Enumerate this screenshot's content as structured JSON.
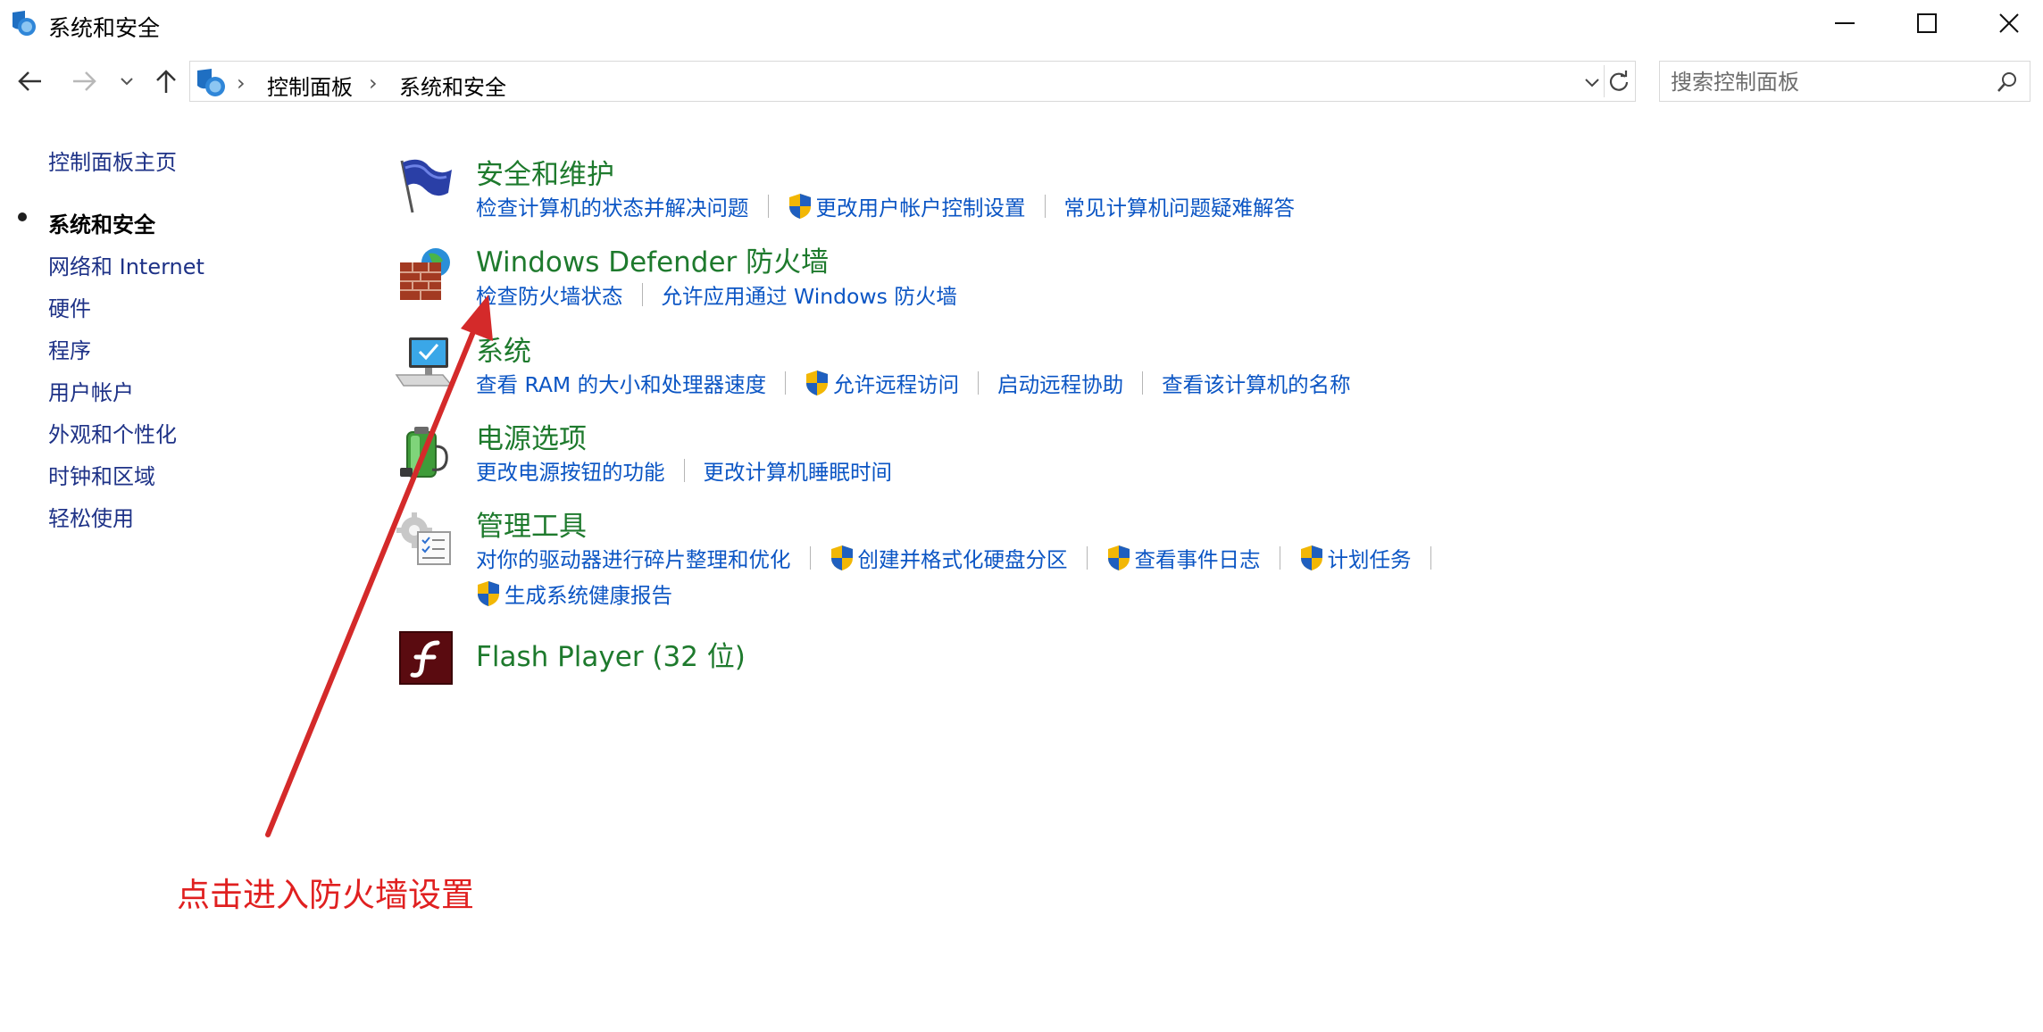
{
  "window": {
    "title": "系统和安全"
  },
  "address": {
    "crumbs": [
      "控制面板",
      "系统和安全"
    ]
  },
  "search": {
    "placeholder": "搜索控制面板"
  },
  "sidebar": {
    "items": [
      {
        "label": "控制面板主页"
      },
      {
        "label": "系统和安全"
      },
      {
        "label": "网络和 Internet"
      },
      {
        "label": "硬件"
      },
      {
        "label": "程序"
      },
      {
        "label": "用户帐户"
      },
      {
        "label": "外观和个性化"
      },
      {
        "label": "时钟和区域"
      },
      {
        "label": "轻松使用"
      }
    ]
  },
  "sections": {
    "security": {
      "title": "安全和维护",
      "links": [
        "检查计算机的状态并解决问题",
        "更改用户帐户控制设置",
        "常见计算机问题疑难解答"
      ]
    },
    "firewall": {
      "title": "Windows Defender 防火墙",
      "links": [
        "检查防火墙状态",
        "允许应用通过 Windows 防火墙"
      ]
    },
    "system": {
      "title": "系统",
      "links": [
        "查看 RAM 的大小和处理器速度",
        "允许远程访问",
        "启动远程协助",
        "查看该计算机的名称"
      ]
    },
    "power": {
      "title": "电源选项",
      "links": [
        "更改电源按钮的功能",
        "更改计算机睡眠时间"
      ]
    },
    "admin": {
      "title": "管理工具",
      "links": [
        "对你的驱动器进行碎片整理和优化",
        "创建并格式化硬盘分区",
        "查看事件日志",
        "计划任务",
        "生成系统健康报告"
      ]
    },
    "flash": {
      "title": "Flash Player (32 位)"
    }
  },
  "annotation": {
    "text": "点击进入防火墙设置"
  },
  "colors": {
    "link": "#0b55c4",
    "section_title": "#1e7a2d",
    "sidebar_link": "#1e3287",
    "annotation": "#e02020"
  }
}
